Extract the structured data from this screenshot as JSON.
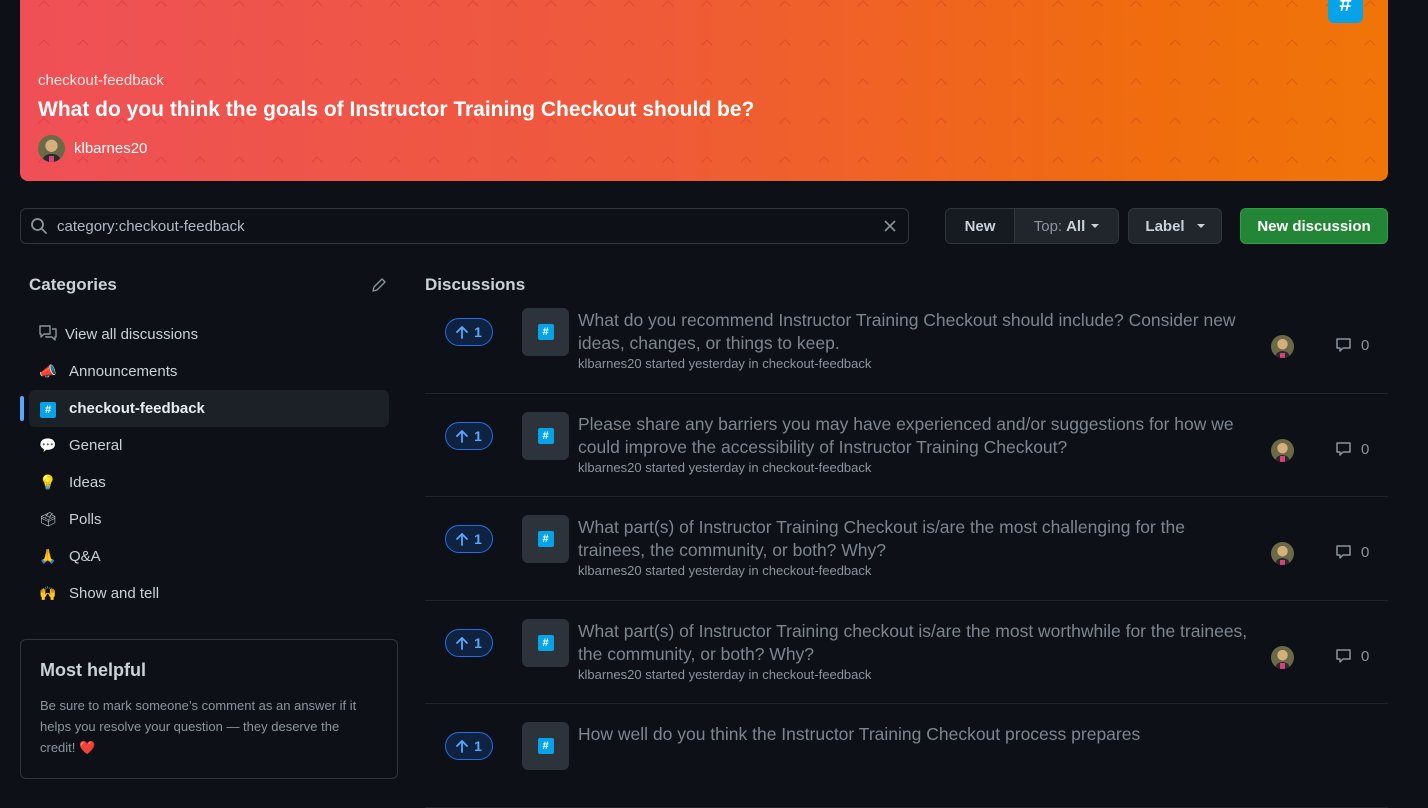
{
  "banner": {
    "category": "checkout-feedback",
    "title": "What do you think the goals of Instructor Training Checkout should be?",
    "author": "klbarnes20",
    "category_icon": "hash-icon",
    "gradient_start": "#ef5057",
    "gradient_end": "#f07508"
  },
  "search": {
    "value": "category:checkout-feedback",
    "clear_icon": "close-icon"
  },
  "toolbar": {
    "sort_new_label": "New",
    "sort_top_label": "Top:",
    "sort_top_value": "All",
    "label_label": "Label",
    "new_discussion_label": "New discussion",
    "new_discussion_color": "#238636"
  },
  "sidebar": {
    "title": "Categories",
    "items": [
      {
        "label": "View all discussions",
        "icon": "discussions-icon"
      },
      {
        "label": "Announcements",
        "icon": "megaphone-icon"
      },
      {
        "label": "checkout-feedback",
        "icon": "hash-icon",
        "active": true
      },
      {
        "label": "General",
        "icon": "speech-bubble-icon"
      },
      {
        "label": "Ideas",
        "icon": "lightbulb-icon"
      },
      {
        "label": "Polls",
        "icon": "ballot-box-icon"
      },
      {
        "label": "Q&A",
        "icon": "pray-icon"
      },
      {
        "label": "Show and tell",
        "icon": "raised-hands-icon"
      }
    ],
    "emojis": [
      "",
      "📣",
      "#",
      "💬",
      "💡",
      "🗳",
      "🙏",
      "🙌"
    ]
  },
  "helpful": {
    "title": "Most helpful",
    "text": "Be sure to mark someone’s comment as an answer if it helps you resolve your question — they deserve the credit! ❤️"
  },
  "discussions": {
    "title": "Discussions",
    "items": [
      {
        "votes": "1",
        "title": "What do you recommend Instructor Training Checkout should include? Consider new ideas, changes, or things to keep.",
        "meta": "klbarnes20 started yesterday in checkout-feedback",
        "comments": "0"
      },
      {
        "votes": "1",
        "title": "Please share any barriers you may have experienced and/or suggestions for how we could improve the accessibility of Instructor Training Checkout?",
        "meta": "klbarnes20 started yesterday in checkout-feedback",
        "comments": "0"
      },
      {
        "votes": "1",
        "title": "What part(s) of Instructor Training Checkout is/are the most challenging for the trainees, the community, or both? Why?",
        "meta": "klbarnes20 started yesterday in checkout-feedback",
        "comments": "0"
      },
      {
        "votes": "1",
        "title": "What part(s) of Instructor Training checkout is/are the most worthwhile for the trainees, the community, or both? Why?",
        "meta": "klbarnes20 started yesterday in checkout-feedback",
        "comments": "0"
      },
      {
        "votes": "1",
        "title": "How well do you think the Instructor Training Checkout process prepares",
        "meta": "",
        "comments": ""
      }
    ]
  }
}
